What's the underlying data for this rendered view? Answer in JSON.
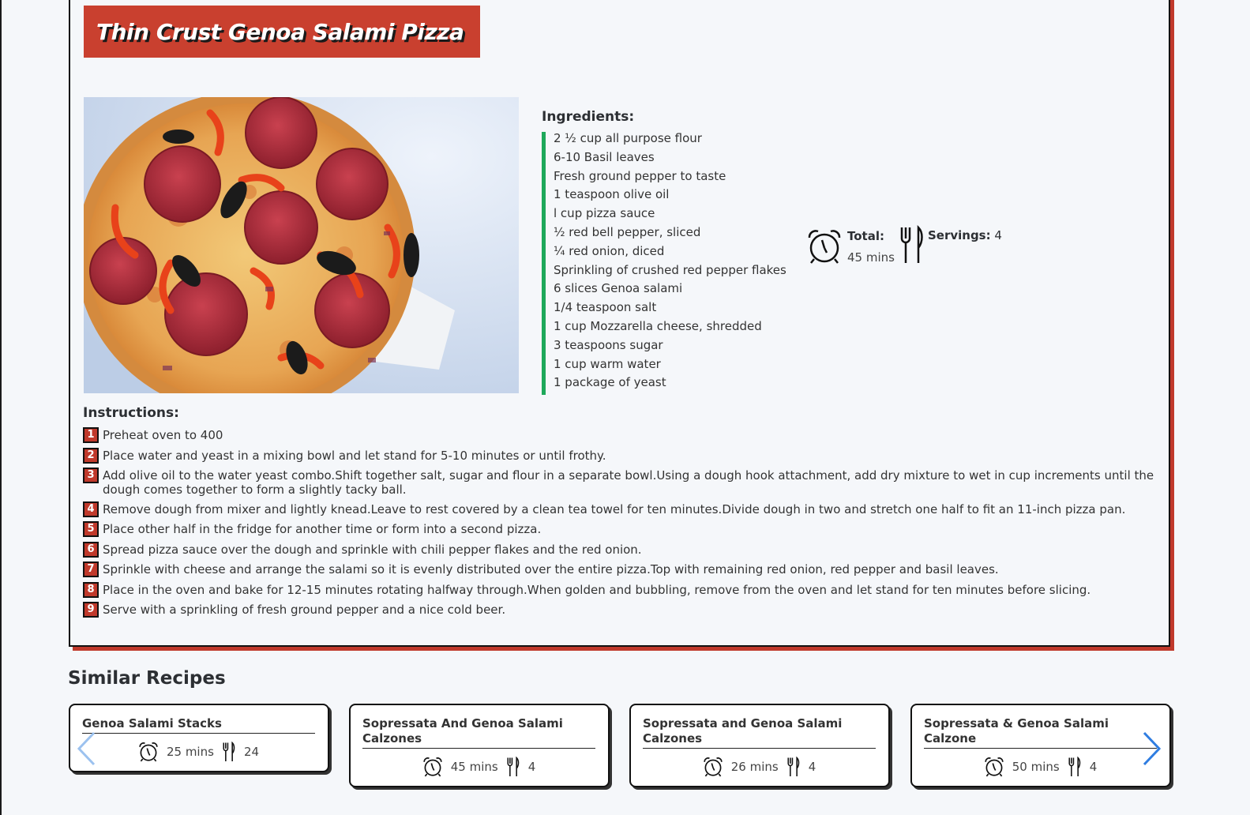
{
  "recipe": {
    "title": "Thin Crust Genoa Salami Pizza",
    "photo_alt": "",
    "ingredients_heading": "Ingredients:",
    "ingredients": [
      "2 ½ cup all purpose flour",
      "6-10 Basil leaves",
      "Fresh ground pepper to taste",
      "1 teaspoon olive oil",
      "l cup pizza sauce",
      "½ red bell pepper, sliced",
      "¼ red onion, diced",
      "Sprinkling of crushed red pepper flakes",
      "6 slices Genoa salami",
      "1/4 teaspoon salt",
      "1 cup Mozzarella cheese, shredded",
      "3 teaspoons sugar",
      "1 cup warm water",
      "1 package of yeast"
    ],
    "total_label": "Total:",
    "total_value": "45 mins",
    "servings_label": "Servings:",
    "servings_value": "4",
    "instructions_heading": "Instructions:",
    "instructions": [
      {
        "num": "1",
        "text": "Preheat oven to 400"
      },
      {
        "num": "2",
        "text": "Place water and yeast in a mixing bowl and let stand for 5-10 minutes or until frothy."
      },
      {
        "num": "3",
        "text": "Add olive oil to the water yeast combo.Shift together salt, sugar and flour in a separate bowl.Using a dough hook attachment, add dry mixture to wet in cup increments until the dough comes together to form a slightly tacky ball."
      },
      {
        "num": "4",
        "text": "Remove dough from mixer and lightly knead.Leave to rest covered by a clean tea towel for ten minutes.Divide dough in two and stretch one half to fit an 11-inch pizza pan."
      },
      {
        "num": "5",
        "text": "Place other half in the fridge for another time or form into a second pizza."
      },
      {
        "num": "6",
        "text": "Spread pizza sauce over the dough and sprinkle with chili pepper flakes and the red onion."
      },
      {
        "num": "7",
        "text": "Sprinkle with cheese and arrange the salami so it is evenly distributed over the entire pizza.Top with remaining red onion, red pepper and basil leaves."
      },
      {
        "num": "8",
        "text": "Place in the oven and bake for 12-15 minutes rotating halfway through.When golden and bubbling, remove from the oven and let stand for ten minutes before slicing."
      },
      {
        "num": "9",
        "text": "Serve with a sprinkling of fresh ground pepper and a nice cold beer."
      }
    ]
  },
  "similar": {
    "heading": "Similar Recipes",
    "recipes": [
      {
        "name": "Genoa Salami Stacks",
        "time": "25 mins",
        "servings": "24"
      },
      {
        "name": "Sopressata And Genoa Salami Calzones",
        "time": "45 mins",
        "servings": "4"
      },
      {
        "name": "Sopressata and Genoa Salami Calzones",
        "time": "26 mins",
        "servings": "4"
      },
      {
        "name": "Sopressata & Genoa Salami Calzone",
        "time": "50 mins",
        "servings": "4"
      }
    ]
  },
  "icons": {
    "time": "alarm-clock-icon",
    "servings": "fork-knife-icon",
    "prev": "chevron-left-icon",
    "next": "chevron-right-icon"
  },
  "colors": {
    "accent_red": "#c9402f",
    "ingredient_bar": "#1ea85a",
    "carousel_arrow": "#2f7de1",
    "background": "#f5f7fa"
  }
}
